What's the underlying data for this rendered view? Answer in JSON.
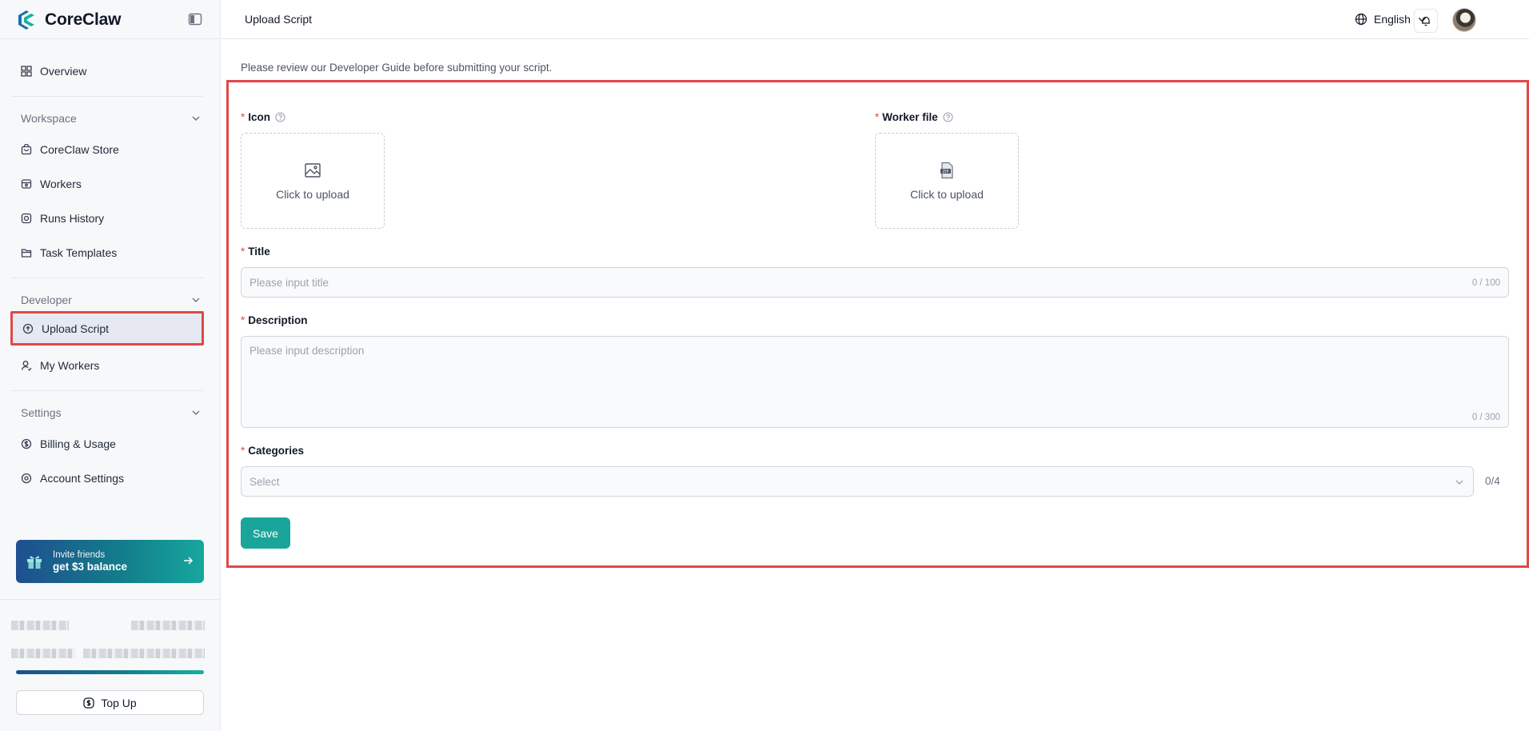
{
  "app": {
    "name": "CoreClaw",
    "brand_color": "#17b0a3",
    "highlight_color": "#e04848"
  },
  "sidebar": {
    "overview": "Overview",
    "sections": [
      {
        "title": "Workspace",
        "items": [
          "CoreClaw Store",
          "Workers",
          "Runs History",
          "Task Templates"
        ]
      },
      {
        "title": "Developer",
        "items": [
          "Upload Script",
          "My Workers"
        ]
      },
      {
        "title": "Settings",
        "items": [
          "Billing & Usage",
          "Account Settings"
        ]
      }
    ],
    "active_item": "Upload Script",
    "invite": {
      "line1": "Invite friends",
      "line2": "get $3 balance"
    },
    "topup_label": "Top Up"
  },
  "header": {
    "title": "Upload Script",
    "language": "English"
  },
  "main": {
    "notice": "Please review our Developer Guide before submitting your script.",
    "required_mark": "*",
    "icon": {
      "label": "Icon",
      "upload_text": "Click to upload"
    },
    "worker_file": {
      "label": "Worker file",
      "upload_text": "Click to upload"
    },
    "title": {
      "label": "Title",
      "placeholder": "Please input title",
      "count": "0 / 100"
    },
    "description": {
      "label": "Description",
      "placeholder": "Please input description",
      "count": "0 / 300"
    },
    "categories": {
      "label": "Categories",
      "placeholder": "Select",
      "count": "0/4"
    },
    "save_label": "Save"
  }
}
